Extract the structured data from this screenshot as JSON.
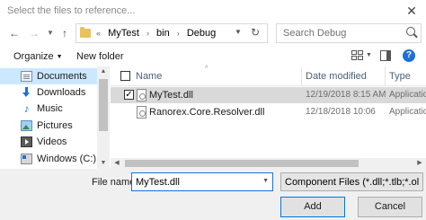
{
  "window": {
    "title": "Select the files to reference..."
  },
  "address": {
    "crumbs": [
      "«",
      "MyTest",
      "›",
      "bin",
      "›",
      "Debug"
    ]
  },
  "search": {
    "placeholder": "Search Debug"
  },
  "toolbar": {
    "organize_label": "Organize",
    "new_folder_label": "New folder"
  },
  "sidebar": {
    "items": [
      {
        "label": "Documents",
        "icon": "documents-icon",
        "selected": true
      },
      {
        "label": "Downloads",
        "icon": "downloads-icon"
      },
      {
        "label": "Music",
        "icon": "music-icon"
      },
      {
        "label": "Pictures",
        "icon": "pictures-icon"
      },
      {
        "label": "Videos",
        "icon": "videos-icon"
      },
      {
        "label": "Windows (C:)",
        "icon": "drive-icon"
      }
    ]
  },
  "filelist": {
    "columns": {
      "name": "Name",
      "date": "Date modified",
      "type": "Type"
    },
    "rows": [
      {
        "name": "MyTest.dll",
        "date": "12/19/2018 8:15 AM",
        "type": "Applicatio",
        "checked": true,
        "selected": true
      },
      {
        "name": "Ranorex.Core.Resolver.dll",
        "date": "12/18/2018 10:06",
        "type": "Applicatio",
        "checked": false,
        "selected": false
      }
    ]
  },
  "footer": {
    "file_name_label": "File name:",
    "file_name_value": "MyTest.dll",
    "filter_value": "Component Files (*.dll;*.tlb;*.ol",
    "add_label": "Add",
    "cancel_label": "Cancel"
  },
  "colors": {
    "accent": "#1e6fd9",
    "selection": "#cce8ff",
    "row_selection": "#d9d9d9"
  }
}
